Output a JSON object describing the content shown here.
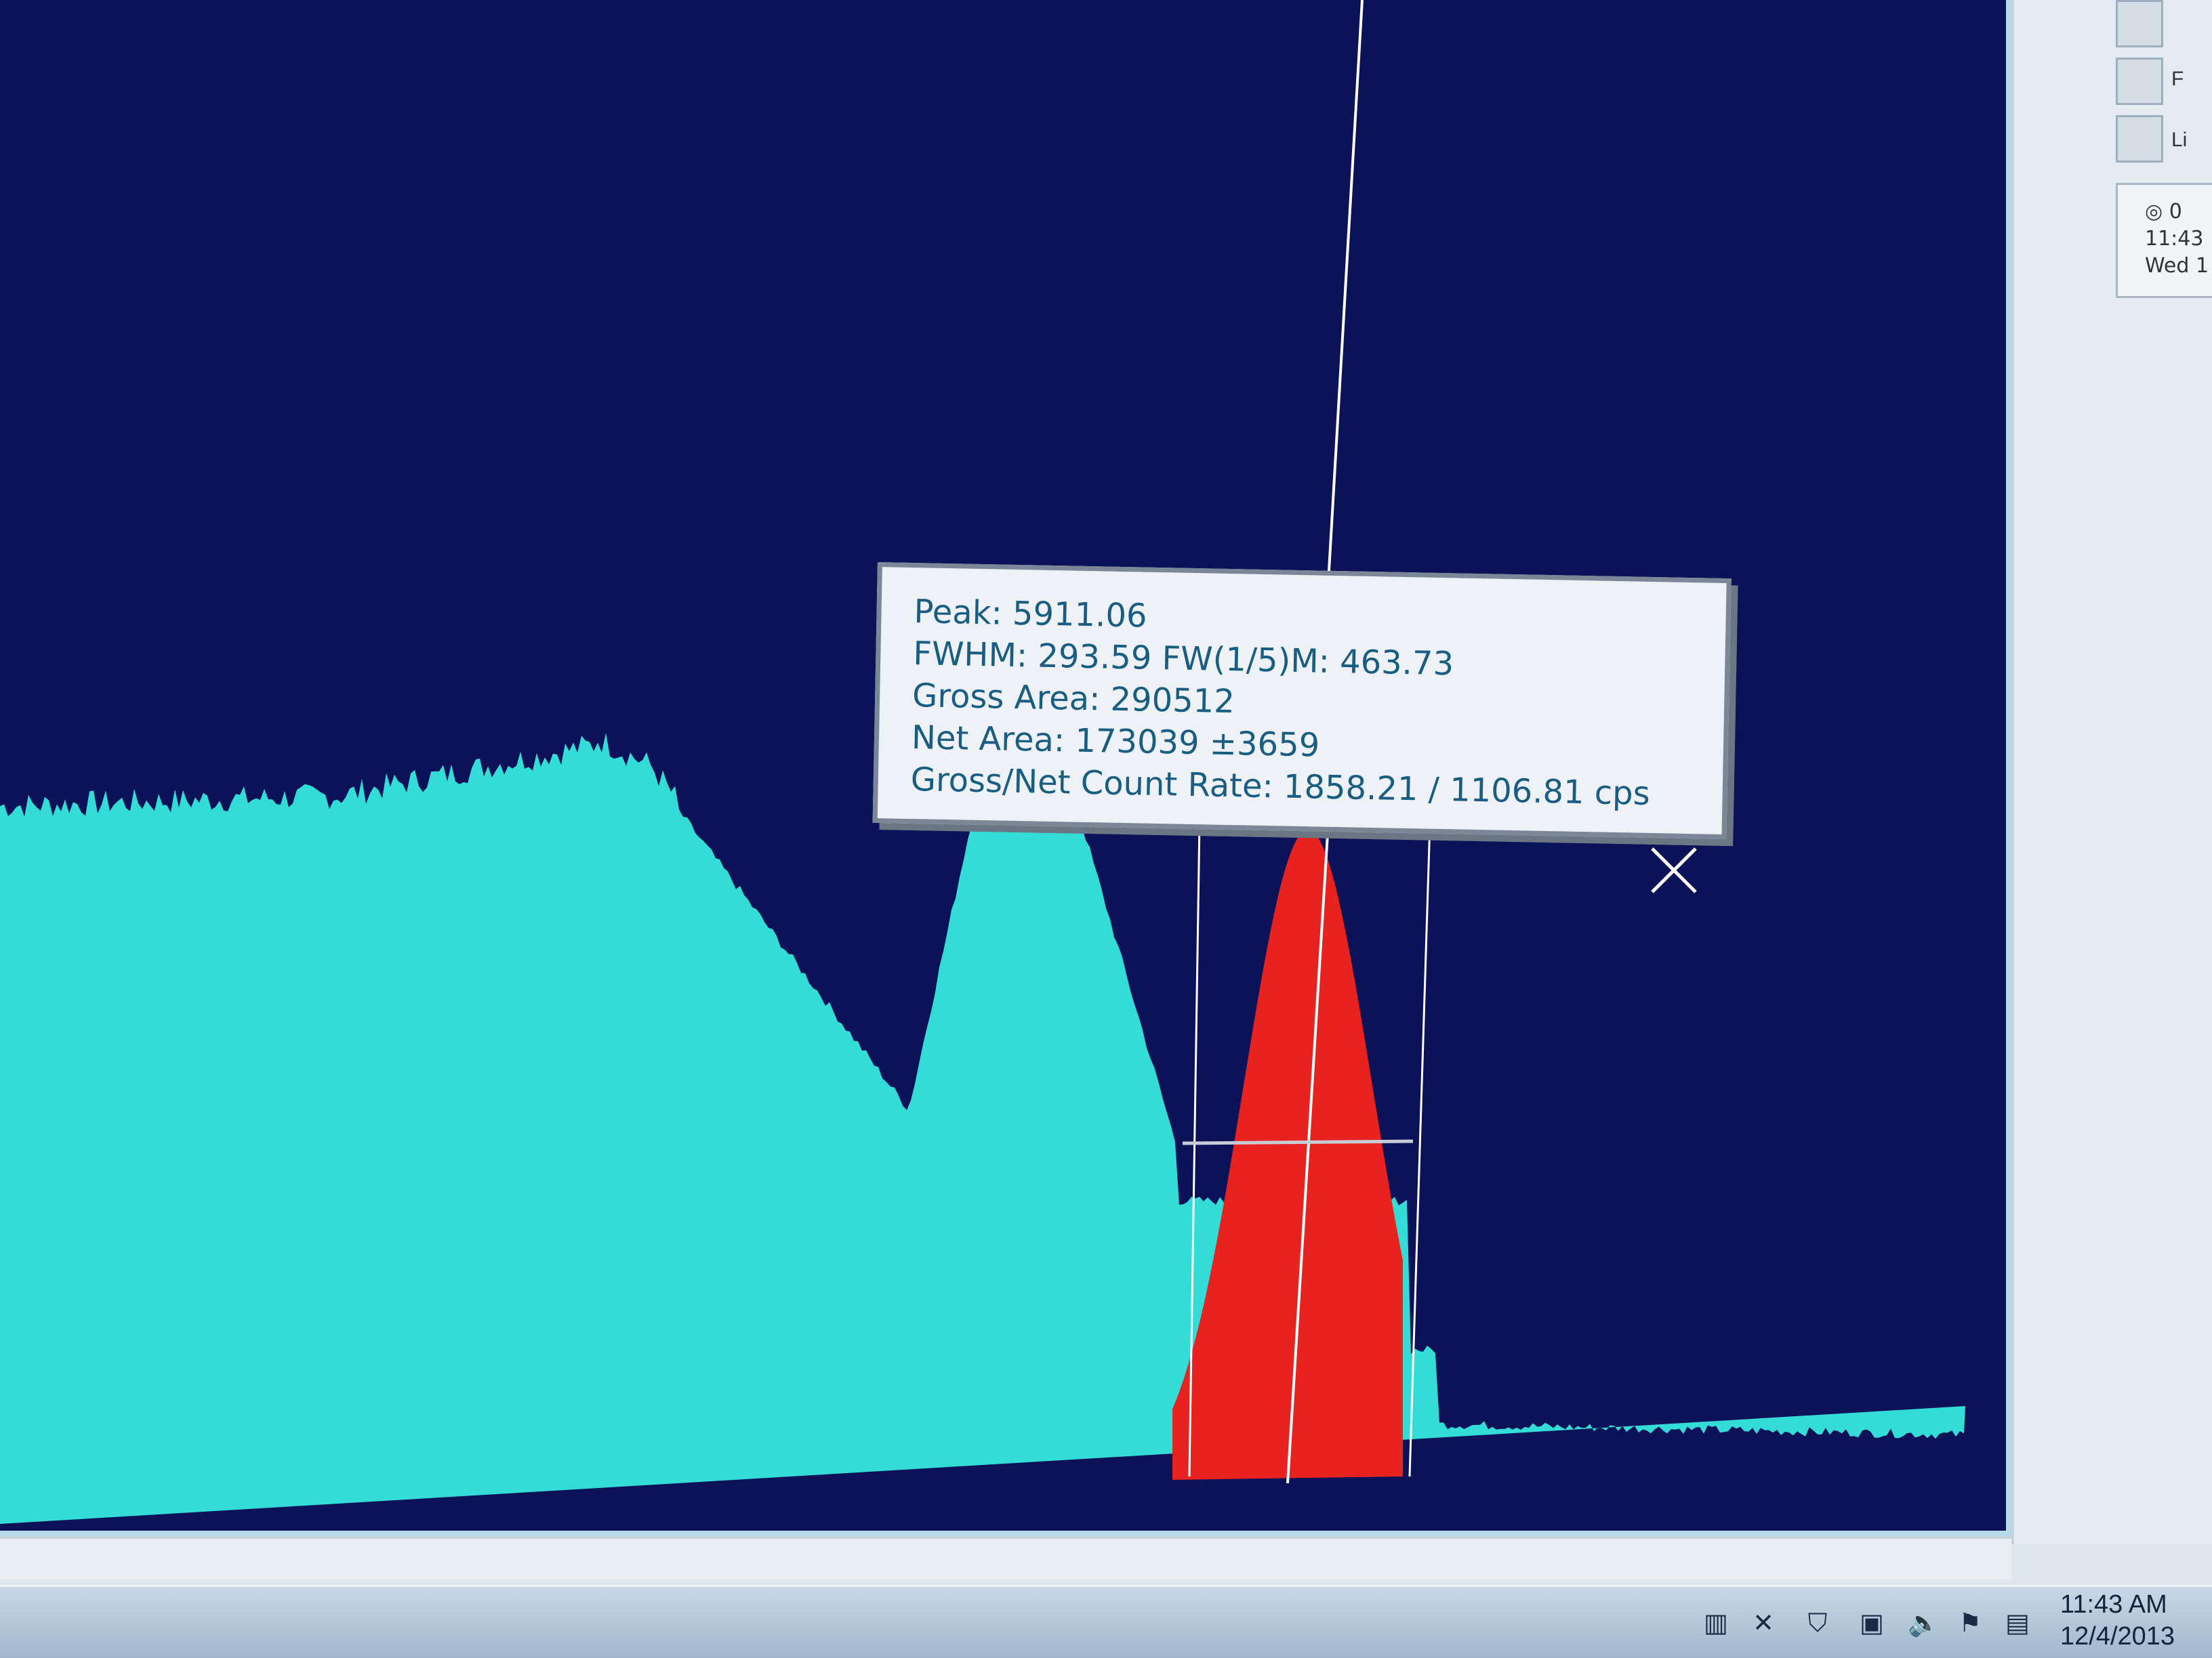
{
  "app": {
    "plot": {
      "background_color": "#0c1257",
      "spectrum_color": "#33dcd6",
      "roi_color": "#e8221e",
      "marker_color": "#ffffff"
    },
    "peak_info": {
      "peak": "Peak: 5911.06",
      "fwhm": "FWHM: 293.59  FW(1/5)M: 463.73",
      "gross_area": "Gross Area: 290512",
      "net_area": "Net Area: 173039 ±3659",
      "count_rate": "Gross/Net Count Rate: 1858.21 / 1106.81 cps"
    },
    "side_panel": {
      "tool_labels": [
        "F",
        "Li"
      ],
      "clock_lines": [
        "◎ 0",
        "11:43",
        "Wed  1"
      ]
    },
    "taskbar": {
      "time": "11:43 AM",
      "date": "12/4/2013",
      "tray_icons": [
        "network-icon",
        "shield-icon",
        "monitor-icon",
        "speaker-icon",
        "flag-icon",
        "keyboard-icon"
      ]
    }
  }
}
